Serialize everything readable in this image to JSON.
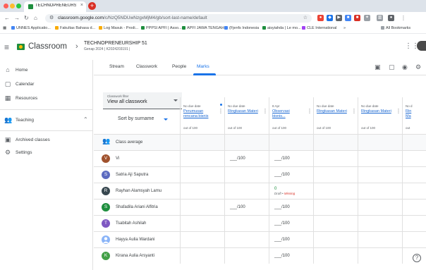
{
  "browser": {
    "tab_title": "TECHNOPRENEURSHIP 51 ...",
    "tab_close": "×",
    "newtab": "+",
    "url_host": "classroom.google.com",
    "url_path": "/c/NzQ5NDUwNzgxMjM4/gb/sort-last-name/default",
    "bookmarks": [
      "UNNES Applicatio...",
      "Fakultas Bahasa d...",
      "Log Masuk - Prodi...",
      "PPPSI APFI | Asso...",
      "APFI JAWA TENGAH",
      "(Fjenfs Indonesia",
      "aisyiahda | Le mo...",
      "CLE International",
      "»",
      "All Bookmarks"
    ],
    "bookmark_colors": [
      "#4285f4",
      "#f9ab00",
      "#f9ab00",
      "#1e8e3e",
      "#1e8e3e",
      "#4285f4",
      "#1e8e3e",
      "#a142f4",
      "#5f6368",
      "#5f6368"
    ]
  },
  "header": {
    "brand": "Classroom",
    "course_title": "TECHNOPRENEURSHIP 51",
    "course_subtitle": "Genap 2024 | K2024203191 |"
  },
  "sidebar": {
    "items": [
      {
        "label": "Home",
        "icon": "⌂"
      },
      {
        "label": "Calendar",
        "icon": "▢"
      },
      {
        "label": "Resources",
        "icon": "▦"
      },
      {
        "label": "Teaching",
        "icon": "👥"
      },
      {
        "label": "Archived classes",
        "icon": "▣"
      },
      {
        "label": "Settings",
        "icon": "⚙"
      }
    ],
    "teaching_chevron": "⌃"
  },
  "tabs": [
    "Stream",
    "Classwork",
    "People",
    "Marks"
  ],
  "filter": {
    "label": "Classwork filter",
    "value": "View all classwork"
  },
  "sort": {
    "label": "Sort by surname"
  },
  "columns": [
    {
      "due": "No due date",
      "title": "Perumusan rencana bisnis",
      "points": "out of 100"
    },
    {
      "due": "No due date",
      "title": "Ringkasan Materi",
      "points": "out of 100"
    },
    {
      "due": "8 Apr",
      "title": "Observasi bisnis...",
      "points": "out of 100"
    },
    {
      "due": "No due date",
      "title": "Ringkasan Materi",
      "points": "out of 100"
    },
    {
      "due": "No due date",
      "title": "Ringkasan Materi",
      "points": "out of 100"
    },
    {
      "due": "No d",
      "title": "Rin Ma",
      "points": "out"
    }
  ],
  "class_average": "Class average",
  "students": [
    {
      "initial": "V",
      "name": "Vi",
      "color": "#a0522d",
      "c1": "",
      "c2": "___/100",
      "c3": "___/100"
    },
    {
      "initial": "S",
      "name": "Satria Aji Saputra",
      "color": "#5c6bc0",
      "c1": "",
      "c2": "",
      "c3": "___/100"
    },
    {
      "initial": "R",
      "name": "Rayhan Alamsyah Lamu",
      "color": "#37474f",
      "c1": "",
      "c2": "",
      "c3": "0",
      "c3_note_prefix": "Draft • ",
      "c3_note": "Missing"
    },
    {
      "initial": "S",
      "name": "Shafadila Ariani Alfitria",
      "color": "#1e8e3e",
      "c1": "",
      "c2": "___/100",
      "c3": "___/100"
    },
    {
      "initial": "T",
      "name": "Tsabitah Ashilah",
      "color": "#7e57c2",
      "c1": "",
      "c2": "",
      "c3": "___/100"
    },
    {
      "initial": "",
      "name": "Hayya Aulia Wardani",
      "color": "#8ab4f8",
      "c1": "",
      "c2": "",
      "c3": "___/100"
    },
    {
      "initial": "K",
      "name": "Kirana Aulia Arsyanti",
      "color": "#43a047",
      "c1": "",
      "c2": "",
      "c3": "___/100"
    }
  ],
  "help": "?"
}
